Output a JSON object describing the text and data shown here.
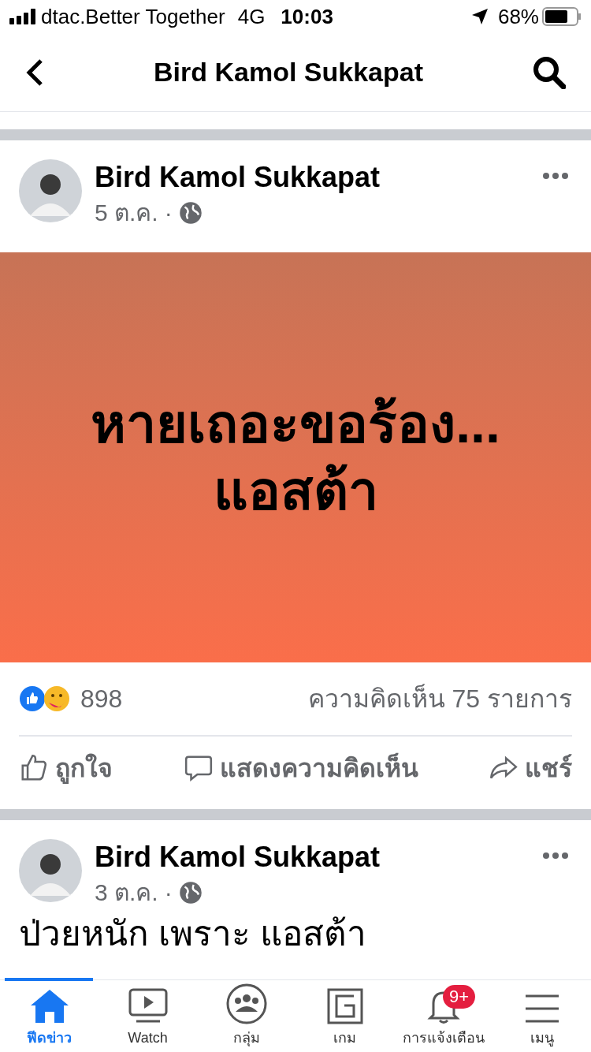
{
  "status_bar": {
    "carrier": "dtac.Better Together",
    "network": "4G",
    "time": "10:03",
    "battery": "68%"
  },
  "header": {
    "title": "Bird Kamol Sukkapat"
  },
  "posts": [
    {
      "author": "Bird Kamol Sukkapat",
      "date": "5 ต.ค.",
      "separator": "·",
      "kind": "image_text",
      "text": "หายเถอะขอร้อง...\nแอสต้า",
      "reactions": "898",
      "comments": "ความคิดเห็น 75 รายการ",
      "actions": [
        "ถูกใจ",
        "แสดงความคิดเห็น",
        "แชร์"
      ]
    },
    {
      "author": "Bird Kamol Sukkapat",
      "date": "3 ต.ค.",
      "separator": "·",
      "kind": "plain_text",
      "text": "ป่วยหนัก เพราะ แอสต้า"
    }
  ],
  "tab_bar": [
    {
      "label": "ฟีดข่าว",
      "selected": true
    },
    {
      "label": "Watch",
      "selected": false
    },
    {
      "label": "กลุ่ม",
      "selected": false
    },
    {
      "label": "เกม",
      "selected": false
    },
    {
      "label": "การแจ้งเตือน",
      "selected": false,
      "badge": "9+"
    },
    {
      "label": "เมนู",
      "selected": false
    }
  ]
}
